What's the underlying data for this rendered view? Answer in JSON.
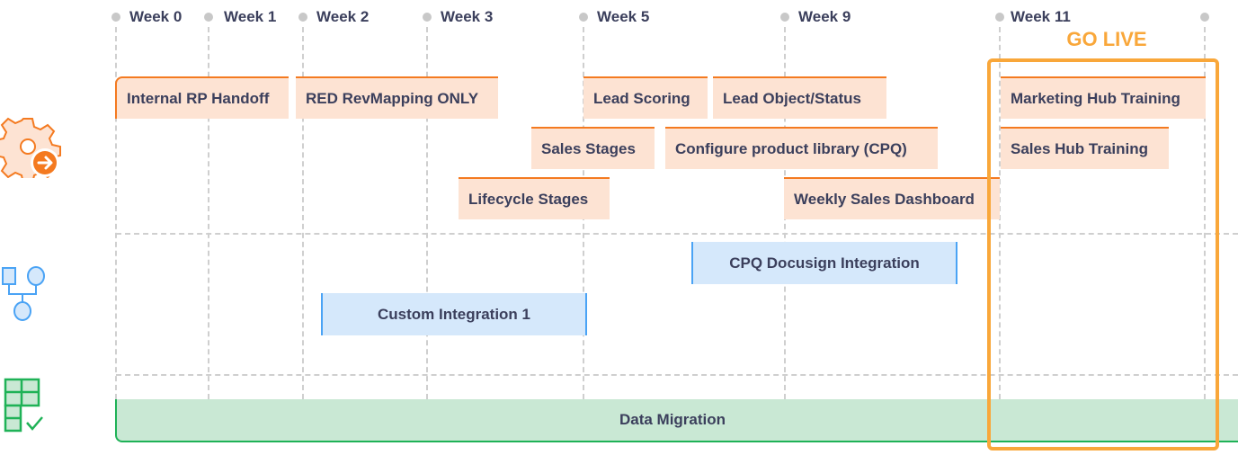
{
  "weeks": [
    "Week 0",
    "Week 1",
    "Week 2",
    "Week 3",
    "Week 5",
    "Week 9",
    "Week 11"
  ],
  "go_live_label": "GO LIVE",
  "lanes": {
    "configuration": {
      "icon": "gear-arrow-icon",
      "tasks": [
        "Internal RP Handoff",
        "RED RevMapping ONLY",
        "Lead Scoring",
        "Lead Object/Status",
        "Marketing Hub Training",
        "Sales Stages",
        "Configure product library (CPQ)",
        "Sales Hub Training",
        "Lifecycle Stages",
        "Weekly Sales Dashboard"
      ]
    },
    "integration": {
      "icon": "integration-nodes-icon",
      "tasks": [
        "CPQ Docusign Integration",
        "Custom Integration 1"
      ]
    },
    "data": {
      "icon": "table-check-icon",
      "tasks": [
        "Data Migration"
      ]
    }
  },
  "colors": {
    "config": "#f47a20",
    "integration": "#4aa3f5",
    "data": "#1fb257",
    "go_live": "#f9a73a"
  }
}
